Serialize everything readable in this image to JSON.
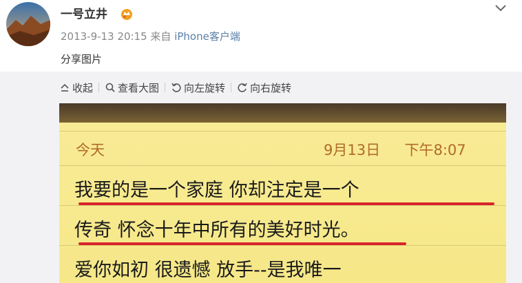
{
  "user": {
    "name": "一号立井",
    "badge_icon": "vip-crown-icon"
  },
  "meta": {
    "datetime": "2013-9-13 20:15",
    "from_label": "来自",
    "source": "iPhone客户端"
  },
  "post_text": "分享图片",
  "toolbar": {
    "collapse": "收起",
    "view_large": "查看大图",
    "rotate_left": "向左旋转",
    "rotate_right": "向右旋转"
  },
  "note": {
    "header_left": "今天",
    "header_date": "9月13日",
    "header_time": "下午8:07",
    "lines": [
      "我要的是一个家庭 你却注定是一个",
      "传奇 怀念十年中所有的美好时光。",
      "爱你如初  很遗憾  放手--是我唯一"
    ]
  },
  "colors": {
    "accent_link": "#5a7fa8",
    "note_paper": "#f6e888",
    "note_header": "#b06a2a",
    "underline": "#d8232a"
  }
}
